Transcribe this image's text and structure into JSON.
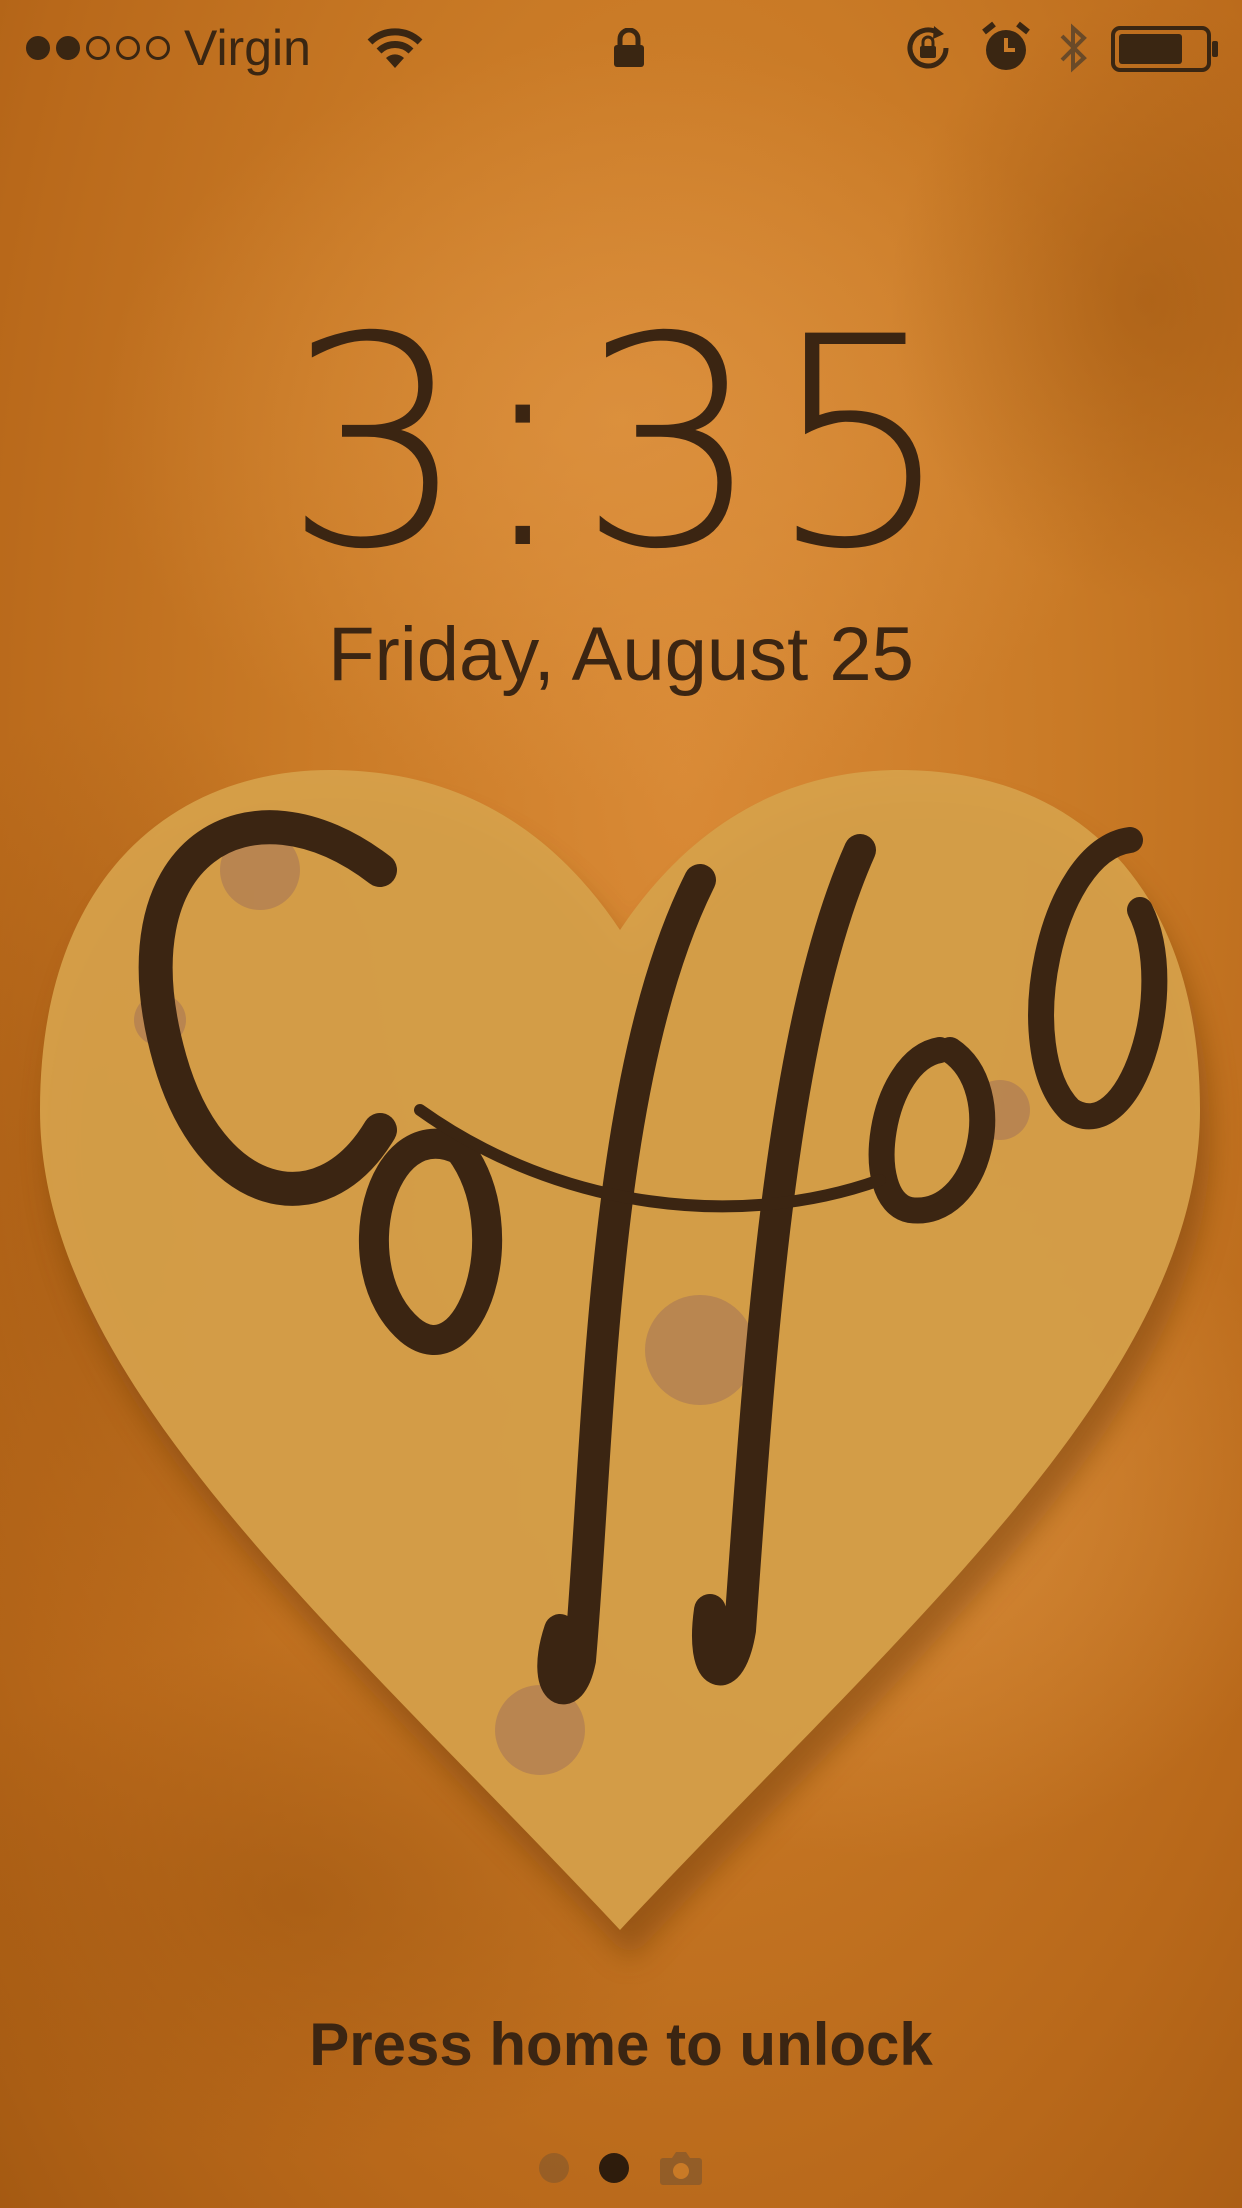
{
  "status_bar": {
    "carrier": "Virgin",
    "signal_strength": 2,
    "signal_max": 5,
    "battery_level": 0.75,
    "icons": [
      "wifi-icon",
      "lock-icon",
      "rotation-lock-icon",
      "alarm-icon",
      "bluetooth-icon",
      "battery-icon"
    ]
  },
  "lock_screen": {
    "time": "3:35",
    "date": "Friday, August 25",
    "unlock_hint": "Press home to unlock",
    "page_dots": 2,
    "active_page": 1,
    "camera_icon": "camera-icon"
  },
  "wallpaper": {
    "artwork": "heart-with-coffee-lettering",
    "background_color": "#c97a26",
    "heart_color": "#d6a04a",
    "text_color": "#3b2512"
  }
}
